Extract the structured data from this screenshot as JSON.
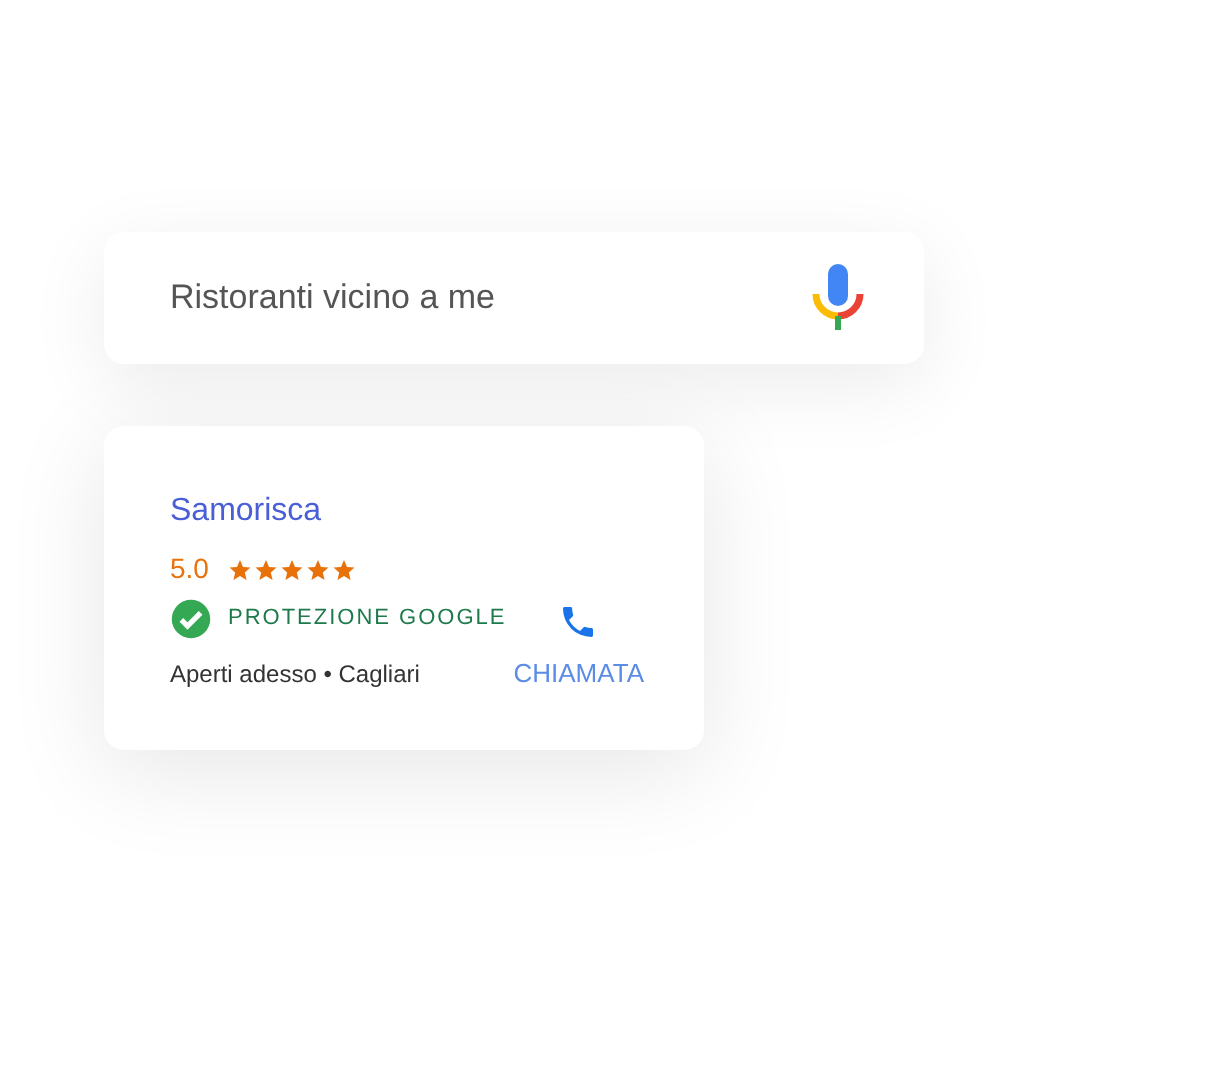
{
  "search": {
    "value": "Ristoranti vicino a me"
  },
  "result": {
    "name": "Samorisca",
    "rating": "5.0",
    "stars": 5,
    "badge": "PROTEZIONE GOOGLE",
    "details": "Aperti adesso • Cagliari",
    "action": "CHIAMATA"
  }
}
